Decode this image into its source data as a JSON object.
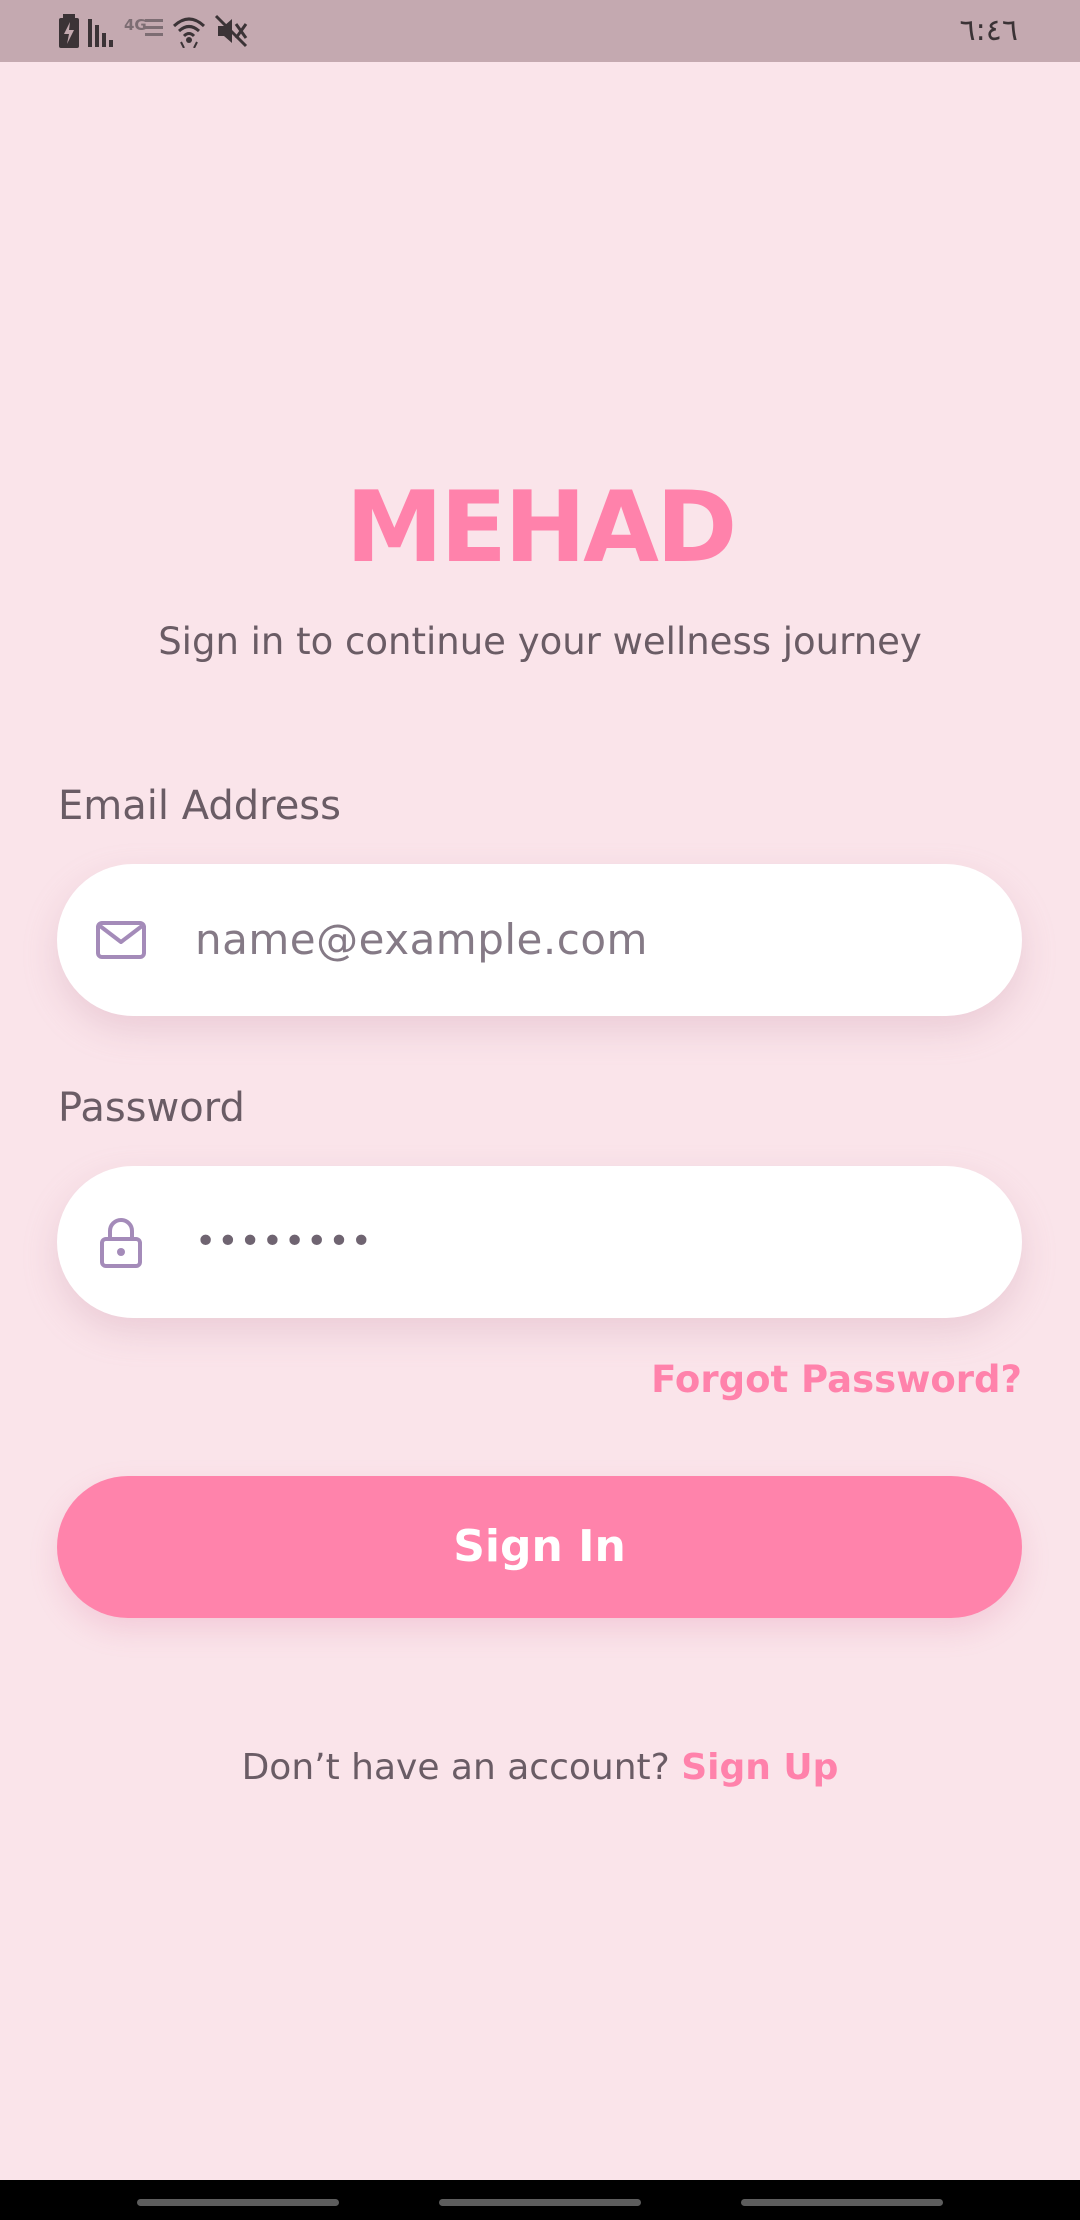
{
  "status_bar": {
    "time": "٦:٤٦",
    "icons": [
      "battery-saver-icon",
      "signal-bars-icon",
      "network-4g-icon",
      "wifi-icon",
      "vibrate-mute-icon"
    ]
  },
  "app": {
    "title": "MEHAD",
    "subtitle": "Sign in to continue your wellness journey"
  },
  "form": {
    "email_label": "Email Address",
    "email_placeholder": "name@example.com",
    "password_label": "Password",
    "password_value": "••••••••",
    "forgot_password": "Forgot Password?",
    "sign_in": "Sign In"
  },
  "footer": {
    "prompt": "Don’t have an account?",
    "sign_up": "Sign Up"
  },
  "colors": {
    "background": "#fae4ea",
    "accent": "#ff82ab",
    "icon": "#a48bb9",
    "text": "#6a5c65"
  }
}
